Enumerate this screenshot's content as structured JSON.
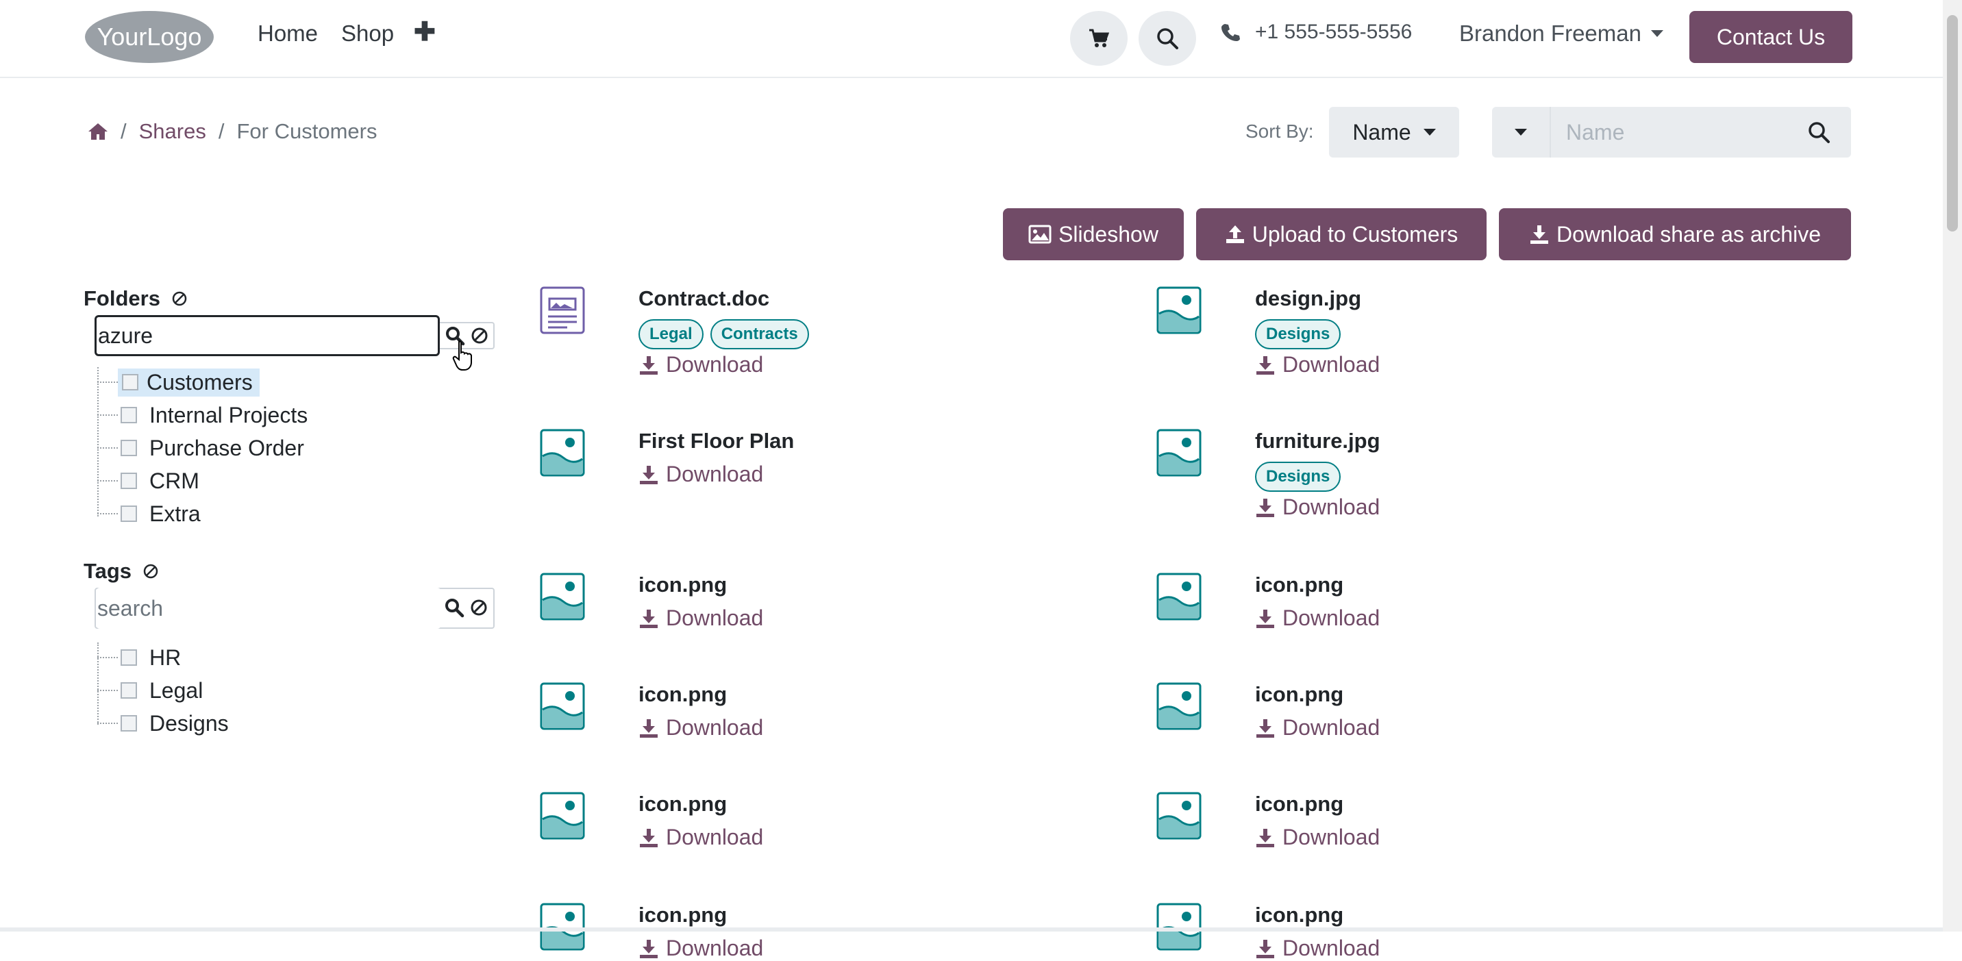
{
  "header": {
    "logo_text": "YourLogo",
    "nav": [
      "Home",
      "Shop"
    ],
    "phone": "+1 555-555-5556",
    "user_name": "Brandon Freeman",
    "contact_label": "Contact Us"
  },
  "breadcrumb": {
    "items": [
      "Shares",
      "For Customers"
    ]
  },
  "sort": {
    "label": "Sort By:",
    "value": "Name",
    "search_placeholder": "Name"
  },
  "actions": {
    "slideshow": "Slideshow",
    "upload": "Upload to Customers",
    "download_archive": "Download share as archive"
  },
  "sidebar": {
    "folders_title": "Folders",
    "folders_filter_value": "azure",
    "folders": [
      "Customers",
      "Internal Projects",
      "Purchase Order",
      "CRM",
      "Extra"
    ],
    "selected_folder": "Customers",
    "tags_title": "Tags",
    "tags_filter_placeholder": "search",
    "tags": [
      "HR",
      "Legal",
      "Designs"
    ]
  },
  "download_label": "Download",
  "files": [
    {
      "name": "Contract.doc",
      "tags": [
        "Legal",
        "Contracts"
      ],
      "icon": "document-icon"
    },
    {
      "name": "design.jpg",
      "tags": [
        "Designs"
      ],
      "icon": "image-icon"
    },
    {
      "name": "First Floor Plan",
      "tags": [],
      "icon": "image-icon"
    },
    {
      "name": "furniture.jpg",
      "tags": [
        "Designs"
      ],
      "icon": "image-icon"
    },
    {
      "name": "icon.png",
      "tags": [],
      "icon": "image-icon"
    },
    {
      "name": "icon.png",
      "tags": [],
      "icon": "image-icon"
    },
    {
      "name": "icon.png",
      "tags": [],
      "icon": "image-icon"
    },
    {
      "name": "icon.png",
      "tags": [],
      "icon": "image-icon"
    },
    {
      "name": "icon.png",
      "tags": [],
      "icon": "image-icon"
    },
    {
      "name": "icon.png",
      "tags": [],
      "icon": "image-icon"
    },
    {
      "name": "icon.png",
      "tags": [],
      "icon": "image-icon"
    },
    {
      "name": "icon.png",
      "tags": [],
      "icon": "image-icon"
    }
  ],
  "colors": {
    "brand": "#714B67",
    "teal": "#017e84",
    "selected_bg": "#d6e9f8"
  }
}
